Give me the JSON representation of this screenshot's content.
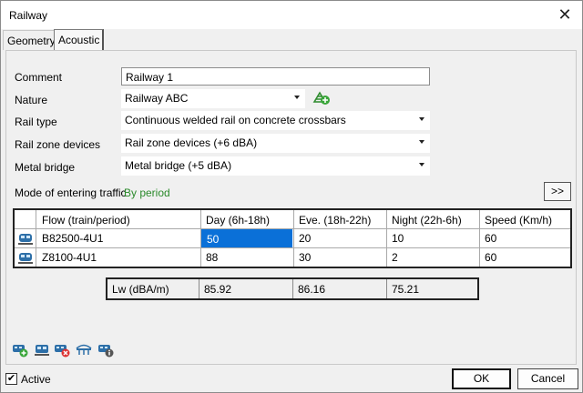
{
  "window": {
    "title": "Railway",
    "close_glyph": "✕"
  },
  "tabs": [
    {
      "label": "Geometry"
    },
    {
      "label": "Acoustic"
    }
  ],
  "form": {
    "comment_label": "Comment",
    "comment_value": "Railway 1",
    "nature_label": "Nature",
    "nature_value": "Railway ABC",
    "rail_type_label": "Rail type",
    "rail_type_value": "Continuous welded rail on concrete crossbars",
    "rail_zone_label": "Rail zone devices",
    "rail_zone_value": "Rail zone devices (+6 dBA)",
    "metal_bridge_label": "Metal bridge",
    "metal_bridge_value": "Metal bridge (+5 dBA)",
    "mode_label": "Mode of entering traffic",
    "mode_value": "By period",
    "expand_label": ">>"
  },
  "traffic_table": {
    "columns": [
      "Flow (train/period)",
      "Day (6h-18h)",
      "Eve. (18h-22h)",
      "Night (22h-6h)",
      "Speed (Km/h)"
    ],
    "rows": [
      {
        "flow": "B82500-4U1",
        "day": "50",
        "eve": "20",
        "night": "10",
        "speed": "60"
      },
      {
        "flow": "Z8100-4U1",
        "day": "88",
        "eve": "30",
        "night": "2",
        "speed": "60"
      }
    ]
  },
  "lw_row": {
    "label": "Lw (dBA/m)",
    "day": "85.92",
    "eve": "86.16",
    "night": "75.21"
  },
  "toolbar_icons": [
    "add-train-icon",
    "train-icon",
    "delete-train-icon",
    "bridge-icon",
    "train-info-icon"
  ],
  "footer": {
    "active_label": "Active",
    "active_checked": true,
    "ok_label": "OK",
    "cancel_label": "Cancel"
  },
  "colors": {
    "selection": "#0a70d8",
    "by_period": "#2b8a2b"
  }
}
